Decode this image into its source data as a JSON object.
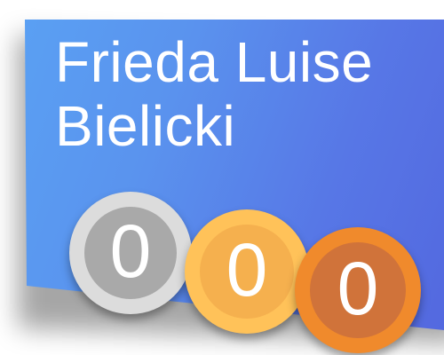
{
  "profile": {
    "first_names": "Frieda Luise",
    "last_name": "Bielicki"
  },
  "medals": [
    {
      "type": "silver",
      "count": "0"
    },
    {
      "type": "gold",
      "count": "0"
    },
    {
      "type": "bronze",
      "count": "0"
    }
  ],
  "colors": {
    "card_light": "#5aa2f4",
    "card_dark": "#5368df",
    "silver_outer": "#dcdcdc",
    "silver_inner": "#a9a9a9",
    "gold_outer": "#ffc259",
    "gold_inner": "#f5b04e",
    "bronze_outer": "#f08a2c",
    "bronze_inner": "#d0733a"
  }
}
